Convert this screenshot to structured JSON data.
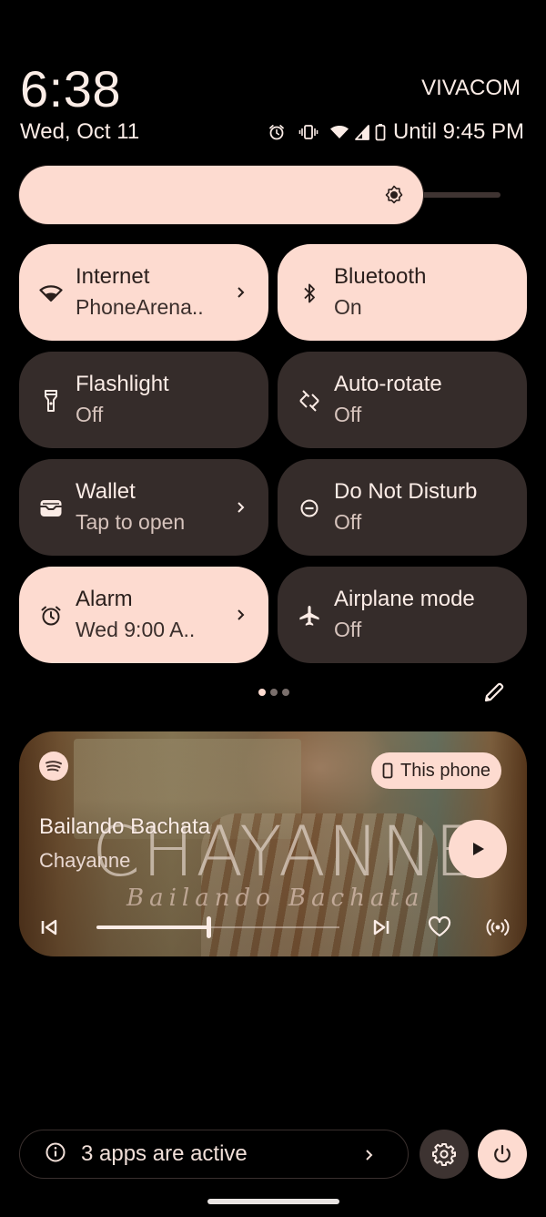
{
  "header": {
    "time": "6:38",
    "date": "Wed, Oct 11",
    "carrier": "VIVACOM",
    "battery_text": "Until 9:45 PM",
    "status_icons": [
      "alarm-icon",
      "vibrate-icon",
      "wifi-icon",
      "cell-signal-icon",
      "battery-icon"
    ]
  },
  "brightness": {
    "level": 0.84,
    "icon": "brightness-icon"
  },
  "tiles": [
    {
      "title": "Internet",
      "subtitle": "PhoneArena..",
      "state": "on",
      "icon": "wifi-icon",
      "has_chevron": true
    },
    {
      "title": "Bluetooth",
      "subtitle": "On",
      "state": "on",
      "icon": "bluetooth-icon",
      "has_chevron": false
    },
    {
      "title": "Flashlight",
      "subtitle": "Off",
      "state": "off",
      "icon": "flashlight-icon",
      "has_chevron": false
    },
    {
      "title": "Auto-rotate",
      "subtitle": "Off",
      "state": "off",
      "icon": "auto-rotate-icon",
      "has_chevron": false
    },
    {
      "title": "Wallet",
      "subtitle": "Tap to open",
      "state": "off",
      "icon": "wallet-icon",
      "has_chevron": true
    },
    {
      "title": "Do Not Disturb",
      "subtitle": "Off",
      "state": "off",
      "icon": "do-not-disturb-icon",
      "has_chevron": false
    },
    {
      "title": "Alarm",
      "subtitle": "Wed 9:00 A..",
      "state": "on",
      "icon": "alarm-icon",
      "has_chevron": true
    },
    {
      "title": "Airplane mode",
      "subtitle": "Off",
      "state": "off",
      "icon": "airplane-icon",
      "has_chevron": false
    }
  ],
  "pager": {
    "pages": 3,
    "current": 1
  },
  "media": {
    "app": "Spotify",
    "output_label": "This phone",
    "song_title": "Bailando Bachata",
    "artist": "Chayanne",
    "album_art_text": "CHAYANNE",
    "album_art_subtext": "Bailando Bachata",
    "progress": 0.46,
    "state": "paused"
  },
  "footer": {
    "active_apps_text": "3 apps are active"
  },
  "colors": {
    "accent": "#fddbd0",
    "tile_off": "#352c2a",
    "background": "#000000",
    "text_on_accent": "#2a1f1c",
    "text_primary": "#fbece6"
  }
}
